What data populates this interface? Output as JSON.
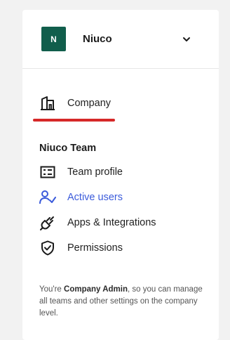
{
  "org": {
    "avatar_letter": "N",
    "name": "Niuco",
    "switcher_icon": "chevron-down-icon"
  },
  "nav": {
    "company": {
      "label": "Company",
      "icon": "building-icon"
    },
    "team_section_title": "Niuco Team",
    "team_items": [
      {
        "label": "Team profile",
        "icon": "id-card-icon"
      },
      {
        "label": "Active users",
        "icon": "user-check-icon"
      },
      {
        "label": "Apps & Integrations",
        "icon": "plug-icon"
      },
      {
        "label": "Permissions",
        "icon": "shield-check-icon"
      }
    ]
  },
  "footnote": {
    "prefix": "You're ",
    "role": "Company Admin",
    "suffix": ", so you can manage all teams and other settings on the company level."
  },
  "colors": {
    "avatar_bg": "#115e4c",
    "link_blue": "#3b5bdb",
    "highlight_red": "#d62828"
  }
}
